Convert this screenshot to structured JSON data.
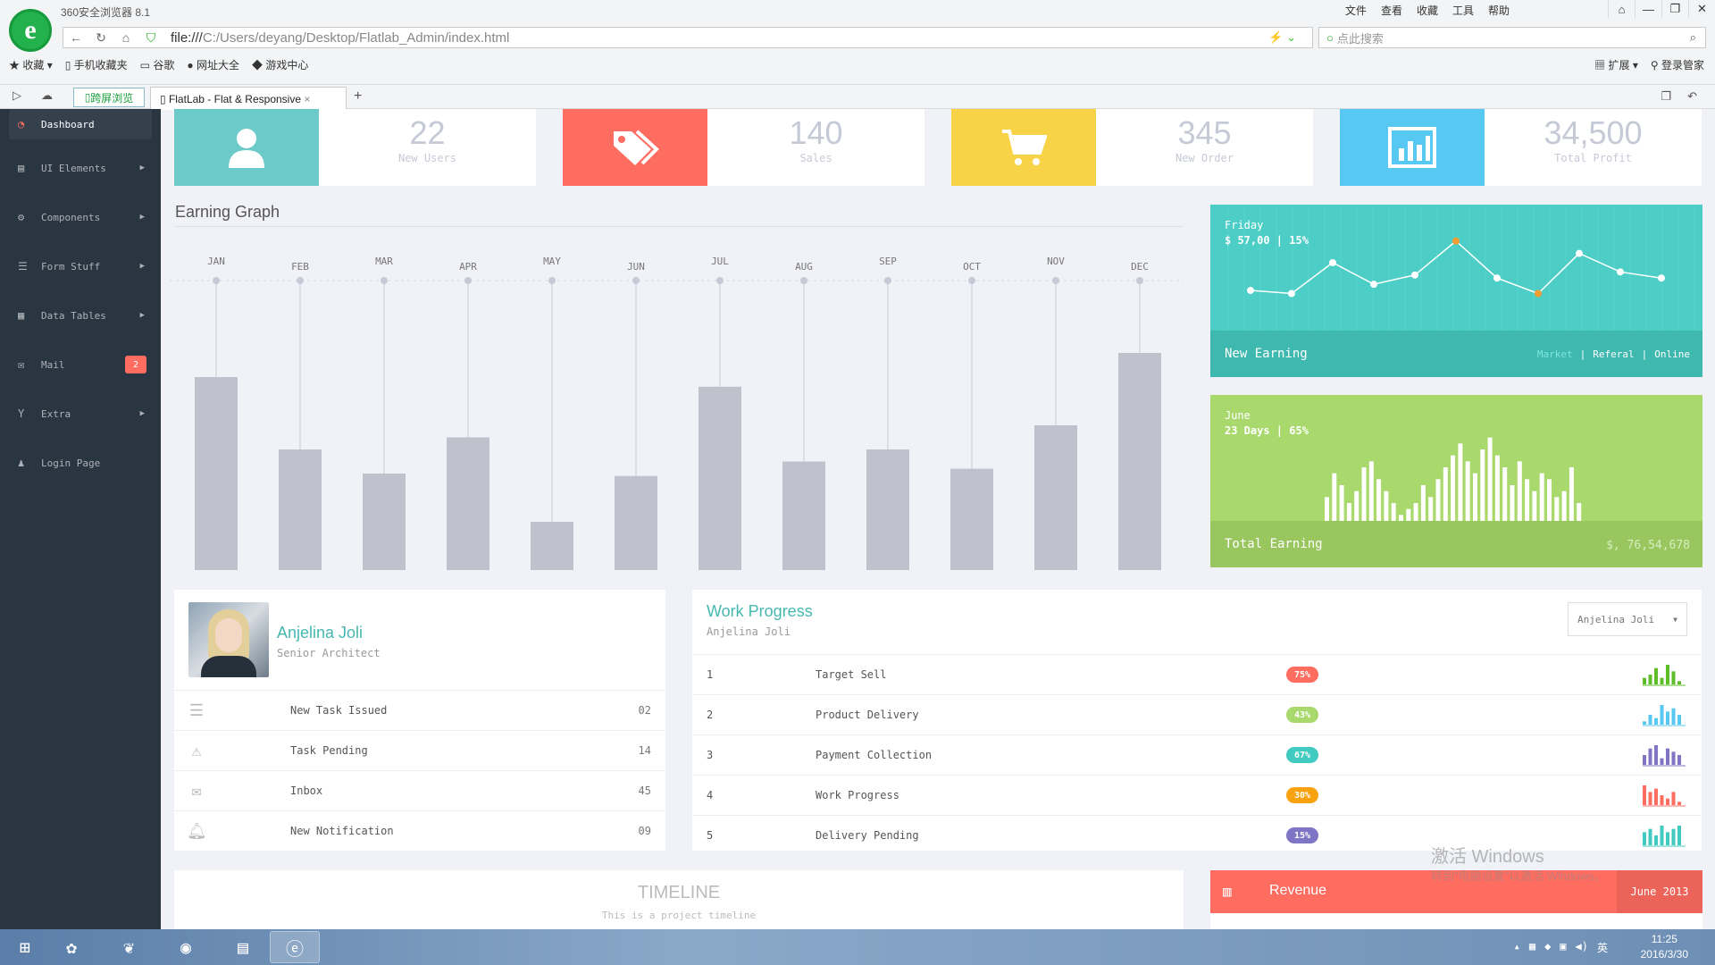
{
  "browser": {
    "title": "360安全浏览器 8.1",
    "menu": [
      "文件",
      "查看",
      "收藏",
      "工具",
      "帮助"
    ],
    "url_prefix": "file:///",
    "url_path": "C:/Users/deyang/Desktop/Flatlab_Admin/index.html",
    "search_placeholder": "点此搜索",
    "favorites": [
      "收藏",
      "手机收藏夹",
      "谷歌",
      "网址大全",
      "游戏中心"
    ],
    "favorites_right": [
      "扩展",
      "登录管家"
    ],
    "tab_green": "跨屏浏览",
    "tab_active": "FlatLab - Flat & Responsive",
    "tab_close": "×"
  },
  "sidebar": {
    "items": [
      {
        "label": "Dashboard",
        "icon": "dashboard-icon"
      },
      {
        "label": "UI Elements",
        "icon": "book-icon"
      },
      {
        "label": "Components",
        "icon": "cogs-icon"
      },
      {
        "label": "Form Stuff",
        "icon": "tasks-icon"
      },
      {
        "label": "Data Tables",
        "icon": "th-icon"
      },
      {
        "label": "Mail",
        "icon": "envelope-icon",
        "badge": "2"
      },
      {
        "label": "Extra",
        "icon": "glass-icon"
      },
      {
        "label": "Login Page",
        "icon": "user-icon"
      }
    ]
  },
  "stats": [
    {
      "value": "22",
      "label": "New Users",
      "color": "#6ccac9",
      "icon": "user-icon"
    },
    {
      "value": "140",
      "label": "Sales",
      "color": "#ff6c60",
      "icon": "tags-icon"
    },
    {
      "value": "345",
      "label": "New Order",
      "color": "#f8d347",
      "icon": "cart-icon"
    },
    {
      "value": "34,500",
      "label": "Total Profit",
      "color": "#57c8f2",
      "icon": "bar-chart-icon"
    }
  ],
  "earning_graph": {
    "title": "Earning Graph"
  },
  "chart_data": {
    "type": "bar",
    "categories": [
      "JAN",
      "FEB",
      "MAR",
      "APR",
      "MAY",
      "JUN",
      "JUL",
      "AUG",
      "SEP",
      "OCT",
      "NOV",
      "DEC"
    ],
    "values": [
      80,
      50,
      40,
      55,
      20,
      39,
      76,
      45,
      50,
      42,
      60,
      90
    ],
    "ylim": [
      0,
      100
    ],
    "title": "Earning Graph"
  },
  "new_earning": {
    "day": "Friday",
    "amount": "$ 57,00 | 15%",
    "footer": "New Earning",
    "links": [
      "Market",
      "Referal",
      "Online"
    ],
    "values": [
      13,
      12,
      22,
      15,
      18,
      29,
      17,
      12,
      25,
      19,
      17
    ],
    "highlight_idx": [
      5,
      7
    ],
    "ylim": [
      0,
      35
    ]
  },
  "total_earning": {
    "month": "June",
    "days": "23 Days | 65%",
    "footer": "Total Earning",
    "amount": "$, 76,54,678",
    "values": [
      4,
      8,
      6,
      3,
      5,
      9,
      10,
      7,
      5,
      3,
      1,
      2,
      3,
      6,
      4,
      7,
      9,
      11,
      13,
      10,
      8,
      12,
      14,
      11,
      9,
      6,
      10,
      7,
      5,
      8,
      7,
      4,
      5,
      9,
      3
    ],
    "ylim": [
      0,
      15
    ]
  },
  "profile": {
    "name": "Anjelina Joli",
    "role": "Senior Architect",
    "rows": [
      {
        "icon": "list-icon",
        "label": "New Task Issued",
        "value": "02"
      },
      {
        "icon": "warning-icon",
        "label": "Task Pending",
        "value": "14"
      },
      {
        "icon": "envelope-icon",
        "label": "Inbox",
        "value": "45"
      },
      {
        "icon": "bell-icon",
        "label": "New Notification",
        "value": "09"
      }
    ]
  },
  "work_progress": {
    "title": "Work Progress",
    "subtitle": "Anjelina Joli",
    "select_value": "Anjelina Joli",
    "rows": [
      {
        "num": "1",
        "label": "Target Sell",
        "pct": "75%",
        "color": "#ff6c60",
        "spark": [
          2,
          3,
          5,
          2,
          6,
          4,
          1
        ],
        "spark_color": "#5fbd2a"
      },
      {
        "num": "2",
        "label": "Product Delivery",
        "pct": "43%",
        "color": "#a9d96c",
        "spark": [
          1,
          3,
          2,
          6,
          4,
          5,
          3
        ],
        "spark_color": "#57c8f2"
      },
      {
        "num": "3",
        "label": "Payment Collection",
        "pct": "67%",
        "color": "#41cac0",
        "spark": [
          3,
          5,
          6,
          2,
          5,
          4,
          3
        ],
        "spark_color": "#8075c4"
      },
      {
        "num": "4",
        "label": "Work Progress",
        "pct": "30%",
        "color": "#f8a20f",
        "spark": [
          6,
          4,
          5,
          3,
          2,
          4,
          1
        ],
        "spark_color": "#ff6c60"
      },
      {
        "num": "5",
        "label": "Delivery Pending",
        "pct": "15%",
        "color": "#8075c4",
        "spark": [
          4,
          5,
          3,
          6,
          4,
          5,
          6
        ],
        "spark_color": "#41cac0"
      }
    ]
  },
  "timeline": {
    "title": "TIMELINE",
    "subtitle": "This is a project timeline"
  },
  "revenue": {
    "title": "Revenue",
    "date": "June 2013"
  },
  "watermark": {
    "line1": "激活 Windows",
    "line2": "转到\"电脑设置\"以激活 Windows。"
  },
  "taskbar": {
    "time": "11:25",
    "date": "2016/3/30",
    "ime": "英"
  }
}
